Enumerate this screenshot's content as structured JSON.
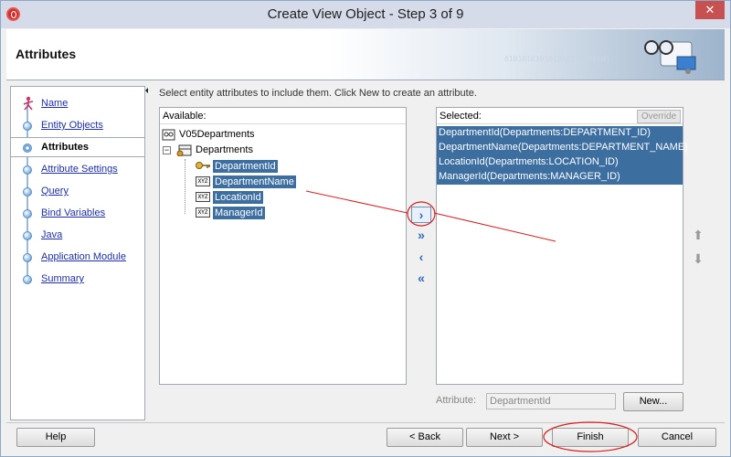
{
  "window": {
    "title": "Create View Object - Step 3 of 9",
    "close_glyph": "✕"
  },
  "header": {
    "title": "Attributes",
    "binary": "010101010101010101010101"
  },
  "nav": {
    "items": [
      {
        "label": "Name"
      },
      {
        "label": "Entity Objects"
      },
      {
        "label": "Attributes",
        "active": true
      },
      {
        "label": "Attribute Settings"
      },
      {
        "label": "Query"
      },
      {
        "label": "Bind Variables"
      },
      {
        "label": "Java"
      },
      {
        "label": "Application Module"
      },
      {
        "label": "Summary"
      }
    ]
  },
  "content": {
    "instruction": "Select entity attributes to include them.  Click New to create an attribute.",
    "available": {
      "header": "Available:",
      "root": "V05Departments",
      "entity": "Departments",
      "attributes": [
        "DepartmentId",
        "DepartmentName",
        "LocationId",
        "ManagerId"
      ],
      "attr_icon_text": "XYZ"
    },
    "selected": {
      "header": "Selected:",
      "override_label": "Override",
      "items": [
        "DepartmentId(Departments:DEPARTMENT_ID)",
        "DepartmentName(Departments:DEPARTMENT_NAME)",
        "LocationId(Departments:LOCATION_ID)",
        "ManagerId(Departments:MANAGER_ID)"
      ]
    },
    "shuttle": {
      "move": "›",
      "move_all": "»",
      "remove": "‹",
      "remove_all": "«"
    },
    "reorder": {
      "up": "⬆",
      "down": "⬇"
    },
    "attribute_label": "Attribute:",
    "attribute_value": "DepartmentId",
    "new_button": "New..."
  },
  "footer": {
    "help": "Help",
    "back": "< Back",
    "next": "Next >",
    "finish": "Finish",
    "cancel": "Cancel"
  },
  "colors": {
    "selection": "#3c6e9f",
    "annotation": "#d42020",
    "link": "#1f2fa0"
  }
}
